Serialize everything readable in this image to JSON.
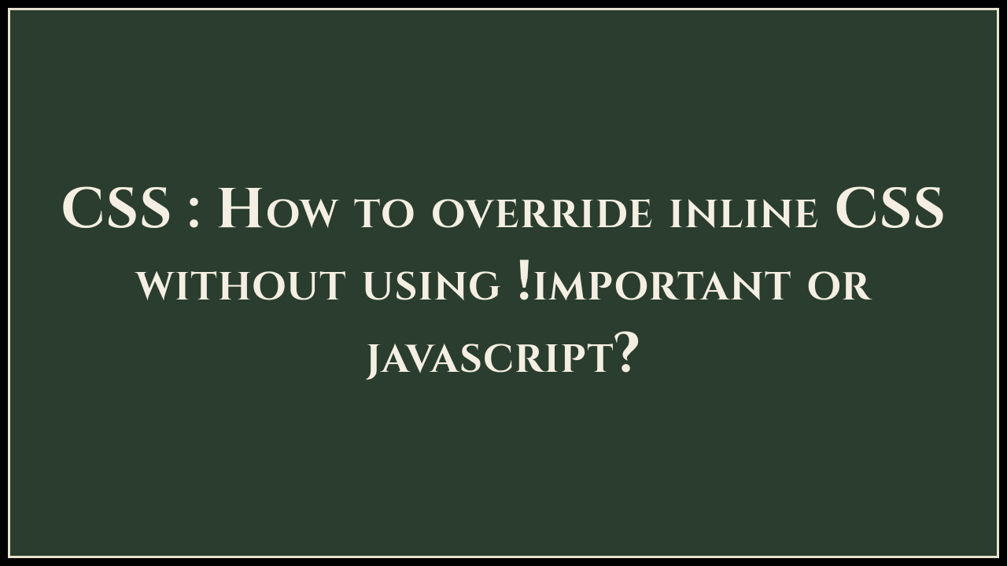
{
  "slide": {
    "title_text": "CSS : How to override inline CSS without using !important or javascript?",
    "background_color": "#2a3d2e",
    "border_color": "#e8e2d0",
    "text_color": "#f4efe2"
  }
}
